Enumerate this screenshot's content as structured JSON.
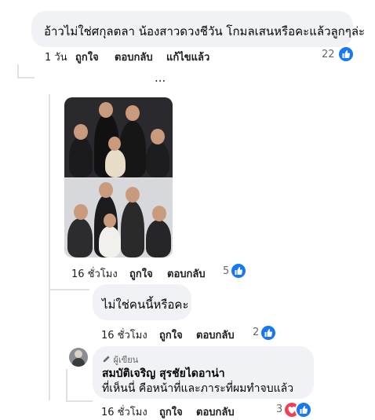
{
  "comments": [
    {
      "text": "อ้าวไม่ใช่ศกุลตลา น้องสาวดวงชีวัน โกมลเสนหรือคะแล้วลูกๆล่ะ",
      "time": "1 วัน",
      "like_label": "ถูกใจ",
      "reply_label": "ตอบกลับ",
      "edited_label": "แก้ไขแล้ว",
      "reaction_count": "22"
    },
    {
      "time": "16 ชั่วโมง",
      "like_label": "ถูกใจ",
      "reply_label": "ตอบกลับ",
      "reaction_count": "5"
    },
    {
      "text": "ไม่ใช่คนนี้หรือคะ",
      "time": "16 ชั่วโมง",
      "like_label": "ถูกใจ",
      "reply_label": "ตอบกลับ",
      "reaction_count": "2"
    },
    {
      "author_badge": "ผู้เขียน",
      "author": "สมบัติเจริญ สุรชัยไดอาน่า",
      "text": "ที่เห็นนี่ คือหน้าที่และภาระที่ผมทำจบแล้ว",
      "time": "16 ชั่วโมง",
      "like_label": "ถูกใจ",
      "reply_label": "ตอบกลับ",
      "reaction_count": "3"
    }
  ],
  "more_replies": "...",
  "icons": {
    "like": "thumbs-up-icon",
    "love": "heart-icon",
    "author": "pencil-icon"
  },
  "colors": {
    "like_blue": "#1877f2",
    "love_red": "#f33e58",
    "bubble": "#f0f2f5",
    "meta_text": "#65676b"
  }
}
